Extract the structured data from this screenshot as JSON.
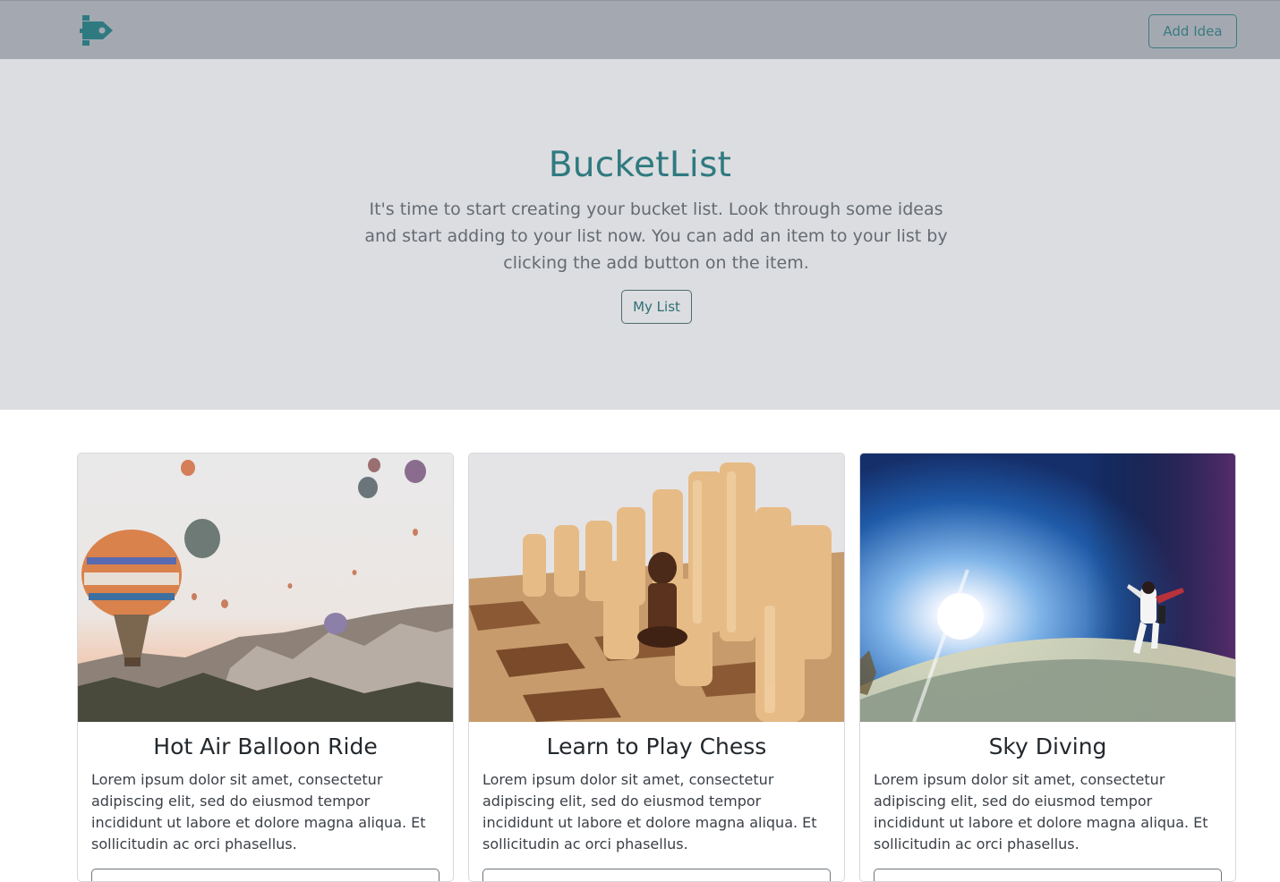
{
  "navbar": {
    "logo_icon": "rocket-logo-icon",
    "add_idea_label": "Add Idea"
  },
  "hero": {
    "title": "BucketList",
    "lead": "It's time to start creating your bucket list. Look through some ideas and start adding to your list now. You can add an item to your list by clicking the add button on the item.",
    "my_list_label": "My List"
  },
  "cards": [
    {
      "title": "Hot Air Balloon Ride",
      "text": "Lorem ipsum dolor sit amet, consectetur adipiscing elit, sed do eiusmod tempor incididunt ut labore et dolore magna aliqua. Et sollicitudin ac orci phasellus."
    },
    {
      "title": "Learn to Play Chess",
      "text": "Lorem ipsum dolor sit amet, consectetur adipiscing elit, sed do eiusmod tempor incididunt ut labore et dolore magna aliqua. Et sollicitudin ac orci phasellus."
    },
    {
      "title": "Sky Diving",
      "text": "Lorem ipsum dolor sit amet, consectetur adipiscing elit, sed do eiusmod tempor incididunt ut labore et dolore magna aliqua. Et sollicitudin ac orci phasellus."
    }
  ],
  "colors": {
    "navbar_bg": "#a4a9b1",
    "hero_bg": "#dcdde0",
    "accent": "#2f7a80"
  }
}
